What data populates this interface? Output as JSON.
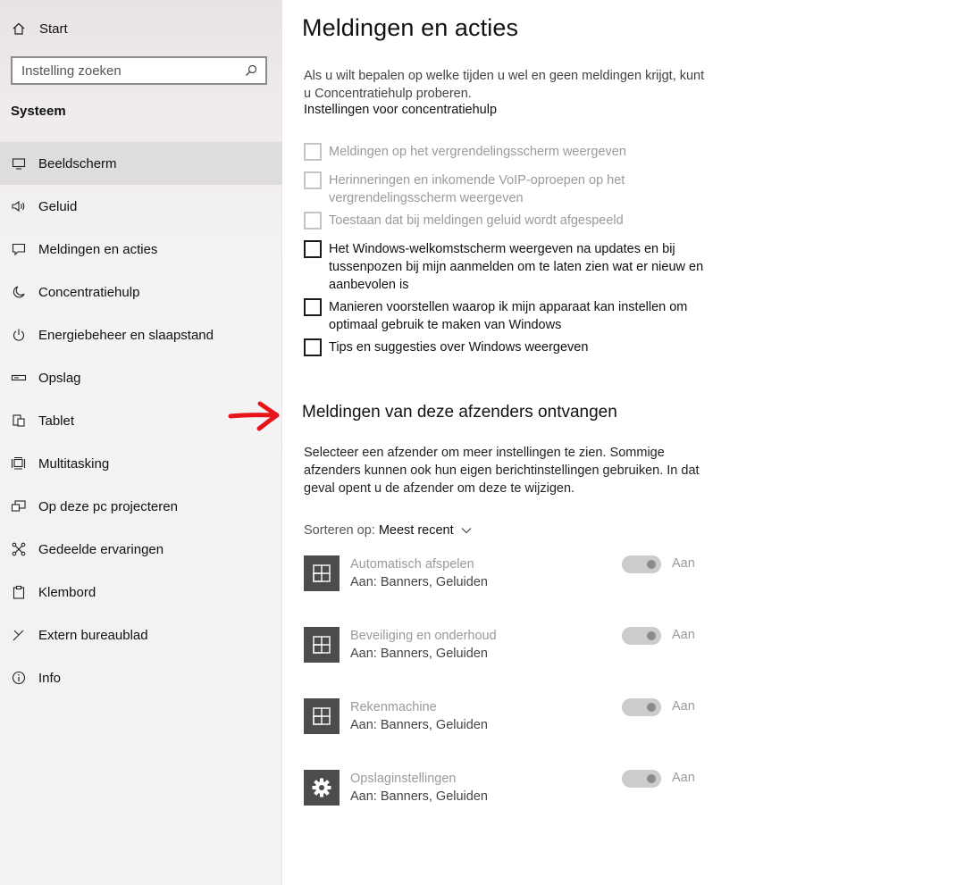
{
  "sidebar": {
    "start_label": "Start",
    "search_placeholder": "Instelling zoeken",
    "section_title": "Systeem",
    "items": [
      {
        "label": "Beeldscherm",
        "icon": "monitor-icon"
      },
      {
        "label": "Geluid",
        "icon": "speaker-icon"
      },
      {
        "label": "Meldingen en acties",
        "icon": "message-icon"
      },
      {
        "label": "Concentratiehulp",
        "icon": "moon-icon"
      },
      {
        "label": "Energiebeheer en slaapstand",
        "icon": "power-icon"
      },
      {
        "label": "Opslag",
        "icon": "storage-icon"
      },
      {
        "label": "Tablet",
        "icon": "tablet-icon"
      },
      {
        "label": "Multitasking",
        "icon": "multitasking-icon"
      },
      {
        "label": "Op deze pc projecteren",
        "icon": "project-icon"
      },
      {
        "label": "Gedeelde ervaringen",
        "icon": "shared-icon"
      },
      {
        "label": "Klembord",
        "icon": "clipboard-icon"
      },
      {
        "label": "Extern bureaublad",
        "icon": "remote-desktop-icon"
      },
      {
        "label": "Info",
        "icon": "info-icon"
      }
    ],
    "active_index": 0
  },
  "main": {
    "title": "Meldingen en acties",
    "intro": "Als u wilt bepalen op welke tijden u wel en geen meldingen krijgt, kunt u Concentratiehulp proberen.",
    "intro_link": "Instellingen voor concentratiehulp",
    "checkboxes": [
      {
        "label": "Meldingen op het vergrendelingsscherm weergeven",
        "enabled": false,
        "checked": false
      },
      {
        "label": "Herinneringen en inkomende VoIP-oproepen op het vergrendelingsscherm weergeven",
        "enabled": false,
        "checked": false
      },
      {
        "label": "Toestaan dat bij meldingen geluid wordt afgespeeld",
        "enabled": false,
        "checked": false
      },
      {
        "label": "Het Windows-welkomstscherm weergeven na updates en bij tussenpozen bij mijn aanmelden om te laten zien wat er nieuw en aanbevolen is",
        "enabled": true,
        "checked": false
      },
      {
        "label": "Manieren voorstellen waarop ik mijn apparaat kan instellen om optimaal gebruik te maken van Windows",
        "enabled": true,
        "checked": false
      },
      {
        "label": "Tips en suggesties over Windows weergeven",
        "enabled": true,
        "checked": false
      }
    ],
    "senders_heading": "Meldingen van deze afzenders ontvangen",
    "senders_desc": "Selecteer een afzender om meer instellingen te zien. Sommige afzenders kunnen ook hun eigen berichtinstellingen gebruiken. In dat geval opent u de afzender om deze te wijzigen.",
    "sort_label": "Sorteren op:",
    "sort_value": "Meest recent",
    "senders": [
      {
        "name": "Automatisch afspelen",
        "sub": "Aan: Banners, Geluiden",
        "toggle_label": "Aan",
        "icon": "app-tile-icon",
        "on": true
      },
      {
        "name": "Beveiliging en onderhoud",
        "sub": "Aan: Banners, Geluiden",
        "toggle_label": "Aan",
        "icon": "app-tile-icon",
        "on": true
      },
      {
        "name": "Rekenmachine",
        "sub": "Aan: Banners, Geluiden",
        "toggle_label": "Aan",
        "icon": "app-tile-icon",
        "on": true
      },
      {
        "name": "Opslaginstellingen",
        "sub": "Aan: Banners, Geluiden",
        "toggle_label": "Aan",
        "icon": "gear-icon",
        "on": true
      }
    ]
  },
  "colors": {
    "annotation_arrow": "#e8141c",
    "app_icon_bg": "#4c4c4c",
    "active_nav_bg": "#dedcdc"
  }
}
